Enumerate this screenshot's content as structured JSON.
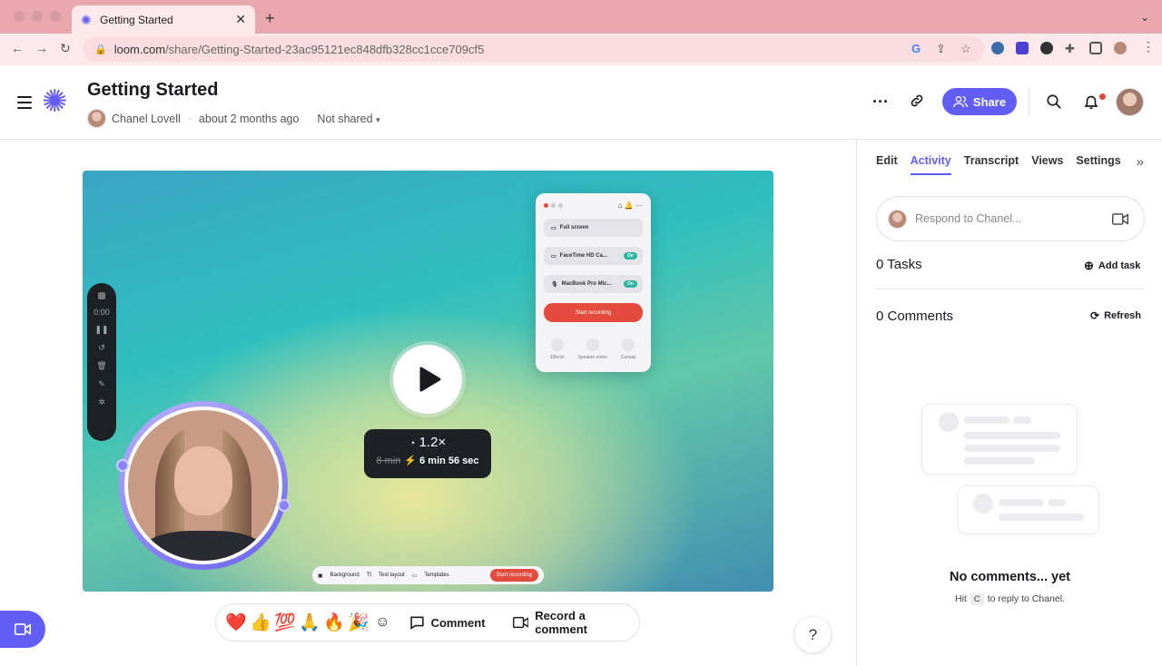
{
  "browser": {
    "tab_title": "Getting Started",
    "tab_close": "✕",
    "new_tab": "+",
    "url_host": "loom.com",
    "url_path": "/share/Getting-Started-23ac95121ec848dfb328cc1cce709cf5"
  },
  "header": {
    "title": "Getting Started",
    "author": "Chanel Lovell",
    "time": "about 2 months ago",
    "sharing": "Not shared",
    "share_label": "Share"
  },
  "video": {
    "speed": "1.2×",
    "orig_duration": "8 min",
    "new_duration": "6 min 56 sec",
    "rec_time": "0:00",
    "popup": {
      "full_screen": "Full screen",
      "camera": "FaceTime HD Ca...",
      "mic": "MacBook Pro Mic...",
      "on": "On",
      "start": "Start recording",
      "effects": "Effects",
      "notes": "Speaker notes",
      "canvas": "Canvas"
    },
    "bar": {
      "background": "Background",
      "text_layout": "Text layout",
      "templates": "Templates",
      "start": "Start recording"
    }
  },
  "reactions": {
    "emojis": [
      "❤️",
      "👍",
      "💯",
      "🙏",
      "🔥",
      "🎉"
    ],
    "comment": "Comment",
    "record_comment": "Record a comment"
  },
  "help": "?",
  "panel": {
    "tabs": [
      "Edit",
      "Activity",
      "Transcript",
      "Views",
      "Settings"
    ],
    "active_tab": "Activity",
    "reply_placeholder": "Respond to Chanel...",
    "tasks": "0 Tasks",
    "add_task": "Add task",
    "comments": "0 Comments",
    "refresh": "Refresh",
    "empty_title": "No comments... yet",
    "hint_pre": "Hit",
    "hint_key": "C",
    "hint_post": "to reply to Chanel."
  },
  "colors": {
    "brand": "#625df5",
    "chrome": "#e9a7ae",
    "record_red": "#e54b3c"
  }
}
